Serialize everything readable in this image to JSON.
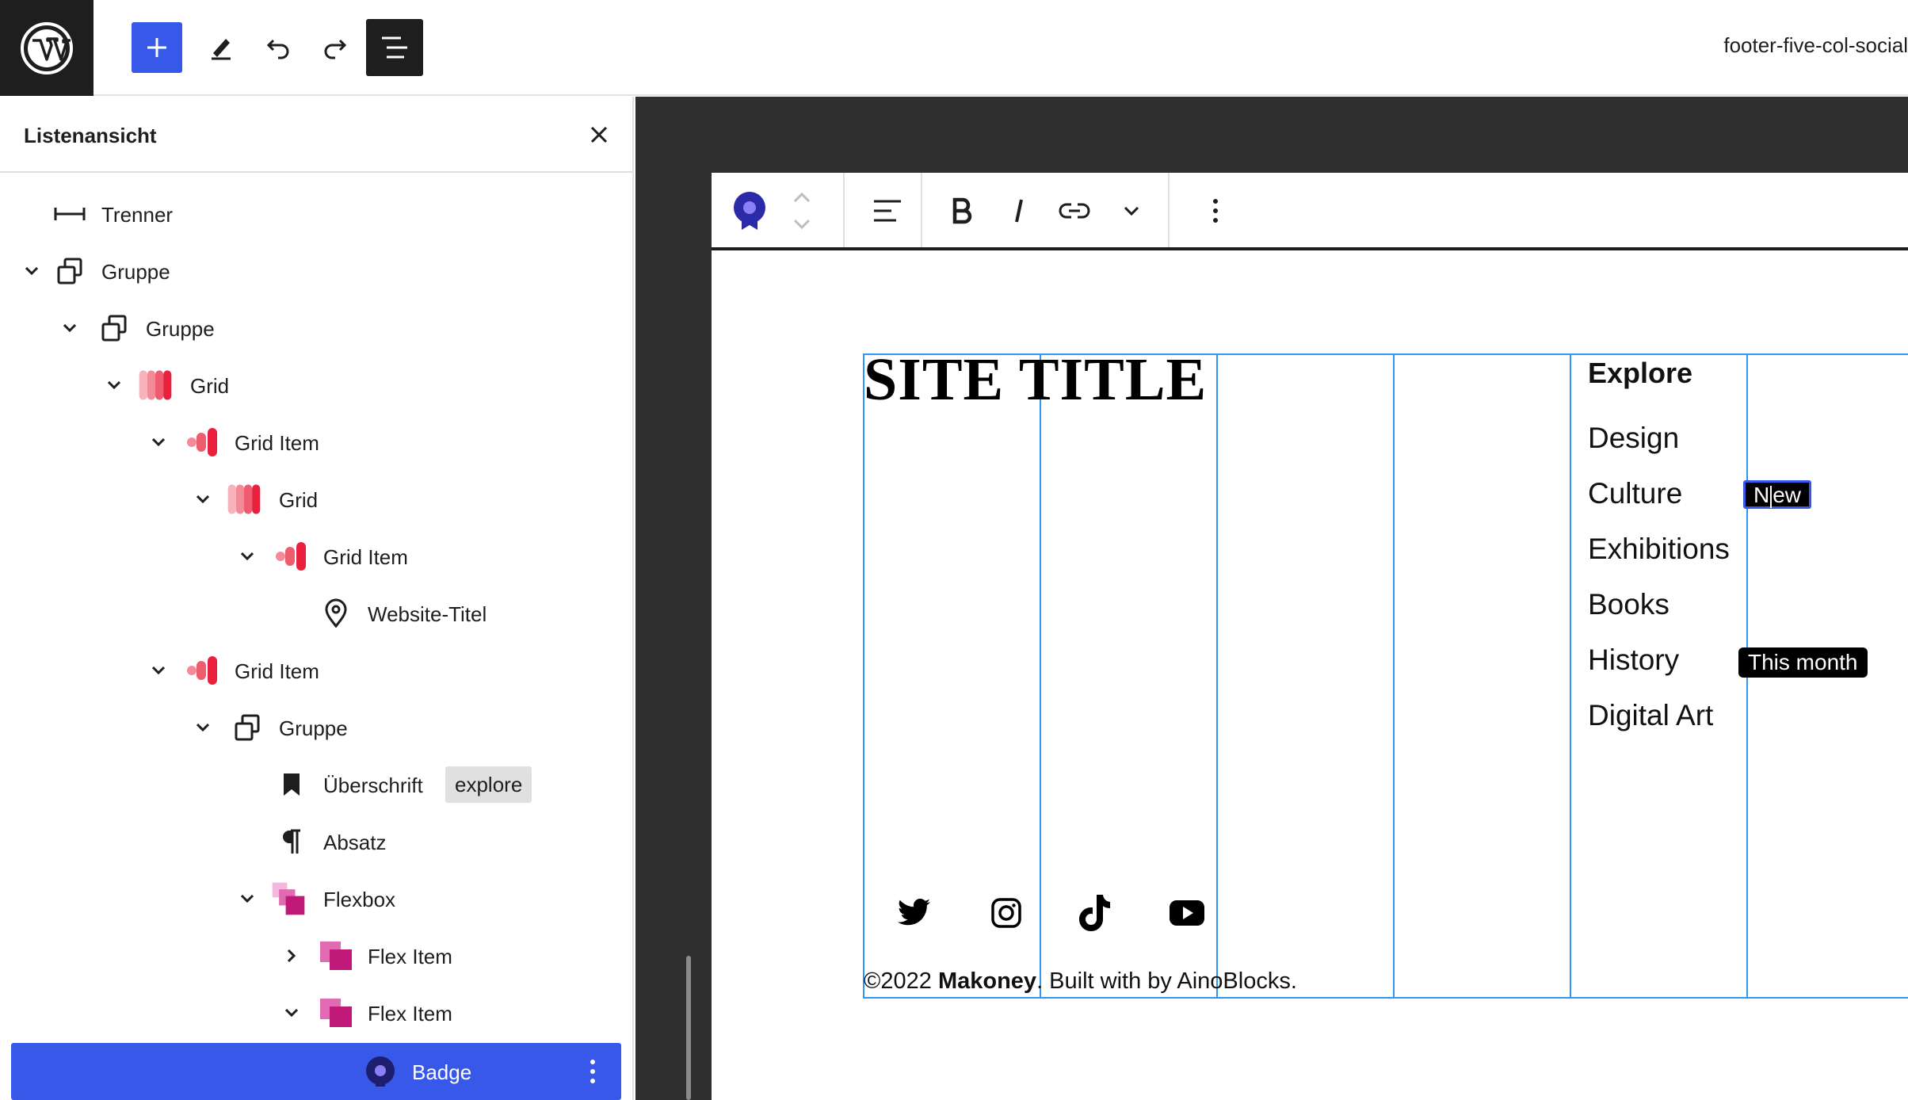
{
  "top_bar": {
    "logo_icon": "wordpress-logo-icon",
    "add_icon": "plus-icon",
    "tools_icon": "pencil-icon",
    "undo_icon": "undo-icon",
    "redo_icon": "redo-icon",
    "list_view_icon": "list-view-icon",
    "document_title": "footer-five-col-social",
    "accent_color": "#3858e9"
  },
  "list_view": {
    "title": "Listenansicht",
    "close_icon": "close-icon",
    "items": [
      {
        "label": "Trenner",
        "icon": "separator-icon",
        "expanded": null
      },
      {
        "label": "Gruppe",
        "icon": "group-icon",
        "expanded": true
      },
      {
        "label": "Gruppe",
        "icon": "group-icon",
        "expanded": true
      },
      {
        "label": "Grid",
        "icon": "grid-icon",
        "expanded": true
      },
      {
        "label": "Grid Item",
        "icon": "grid-item-icon",
        "expanded": true
      },
      {
        "label": "Grid",
        "icon": "grid-icon",
        "expanded": true
      },
      {
        "label": "Grid Item",
        "icon": "grid-item-icon",
        "expanded": true
      },
      {
        "label": "Website-Titel",
        "icon": "map-marker-icon",
        "expanded": null
      },
      {
        "label": "Grid Item",
        "icon": "grid-item-icon",
        "expanded": true
      },
      {
        "label": "Gruppe",
        "icon": "group-icon",
        "expanded": true
      },
      {
        "label": "Überschrift",
        "icon": "bookmark-icon",
        "tag": "explore",
        "expanded": null
      },
      {
        "label": "Absatz",
        "icon": "paragraph-icon",
        "expanded": null
      },
      {
        "label": "Flexbox",
        "icon": "flexbox-icon",
        "expanded": true
      },
      {
        "label": "Flex Item",
        "icon": "flex-item-icon",
        "expanded": false
      },
      {
        "label": "Flex Item",
        "icon": "flex-item-icon",
        "expanded": true
      },
      {
        "label": "Badge",
        "icon": "badge-icon",
        "selected": true
      }
    ],
    "selected_color": "#3858e9"
  },
  "block_toolbar": {
    "block_icon": "badge-icon",
    "move_up_icon": "chevron-up-icon",
    "move_down_icon": "chevron-down-icon",
    "align_icon": "align-left-icon",
    "bold_icon": "bold-icon",
    "italic_icon": "italic-icon",
    "link_icon": "link-icon",
    "more_formats_icon": "chevron-down-icon",
    "options_icon": "more-vertical-icon"
  },
  "content": {
    "site_title": "SITE TITLE",
    "explore_heading": "Explore",
    "nav_links": [
      "Design",
      "Culture",
      "Exhibitions",
      "Books",
      "History",
      "Digital Art"
    ],
    "badge_new": "New",
    "badge_new_before_caret": "N",
    "badge_new_after_caret": "ew",
    "badge_month": "This month",
    "social_icons": [
      "twitter-icon",
      "instagram-icon",
      "tiktok-icon",
      "youtube-icon"
    ],
    "footer_prefix": "©2022",
    "footer_brand": "Makoney",
    "footer_suffix": ". Built with by AinoBlocks.",
    "grid_outline_color": "#2f95f0"
  }
}
